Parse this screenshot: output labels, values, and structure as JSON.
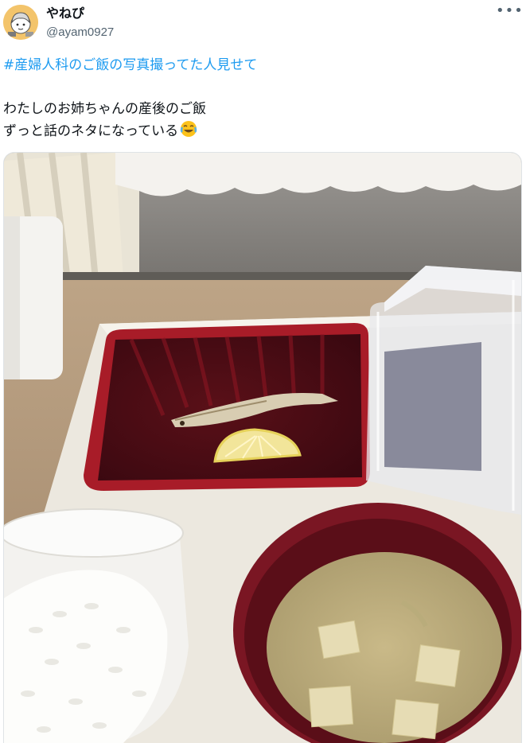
{
  "author": {
    "display_name": "やねぴ",
    "handle": "@ayam0927",
    "avatar_icon": "avatar-illustration",
    "more_icon": "more-dots-icon"
  },
  "tweet": {
    "hashtag": "#産婦人科のご飯の写真撮ってた人見せて",
    "lines": [
      "わたしのお姉ちゃんの産後のご飯",
      "ずっと話のネタになっている"
    ],
    "emoji": "face-with-tears-of-joy"
  },
  "photo": {
    "subject": "hospital-meal-tray"
  },
  "colors": {
    "link": "#1d9bf0",
    "text": "#0f1419",
    "secondary": "#536471"
  }
}
